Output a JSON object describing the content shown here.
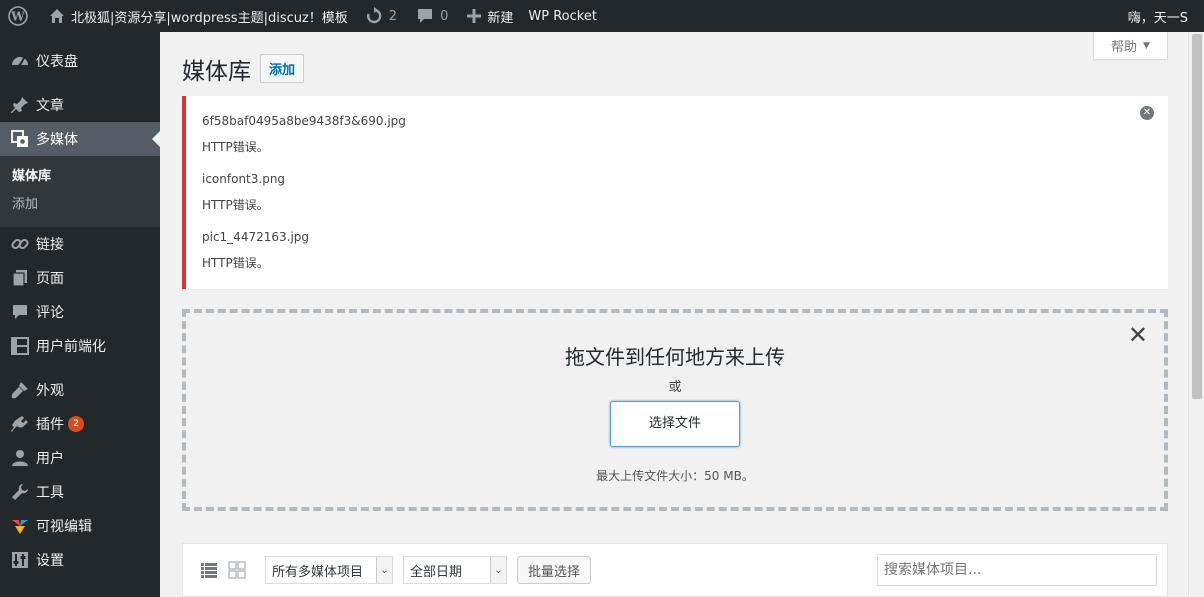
{
  "adminbar": {
    "site_name": "北极狐|资源分享|wordpress主题|discuz！模板",
    "updates_count": "2",
    "comments_count": "0",
    "new_label": "新建",
    "wp_rocket": "WP Rocket",
    "greeting": "嗨，天一S"
  },
  "sidebar": {
    "dashboard": "仪表盘",
    "posts": "文章",
    "media": "多媒体",
    "media_library": "媒体库",
    "media_add": "添加",
    "links": "链接",
    "pages": "页面",
    "comments": "评论",
    "frontend": "用户前端化",
    "appearance": "外观",
    "plugins": "插件",
    "plugins_badge": "2",
    "users": "用户",
    "tools": "工具",
    "visual_editor": "可视编辑",
    "settings": "设置"
  },
  "main": {
    "page_title": "媒体库",
    "add_button": "添加",
    "help": "帮助",
    "errors": [
      {
        "file": "6f58baf0495a8be9438f3&690.jpg",
        "message": "HTTP错误。"
      },
      {
        "file": "iconfont3.png",
        "message": "HTTP错误。"
      },
      {
        "file": "pic1_4472163.jpg",
        "message": "HTTP错误。"
      }
    ],
    "upload": {
      "title": "拖文件到任何地方来上传",
      "or": "或",
      "select_button": "选择文件",
      "max_size": "最大上传文件大小：50 MB。"
    },
    "toolbar": {
      "type_filter": "所有多媒体项目",
      "date_filter": "全部日期",
      "bulk_select": "批量选择",
      "search_placeholder": "搜索媒体项目..."
    }
  },
  "colors": {
    "adminbar_bg": "#23282d",
    "sidebar_bg": "#23282d",
    "error_border": "#dc3232",
    "link_blue": "#0073aa",
    "badge": "#d54e21"
  }
}
